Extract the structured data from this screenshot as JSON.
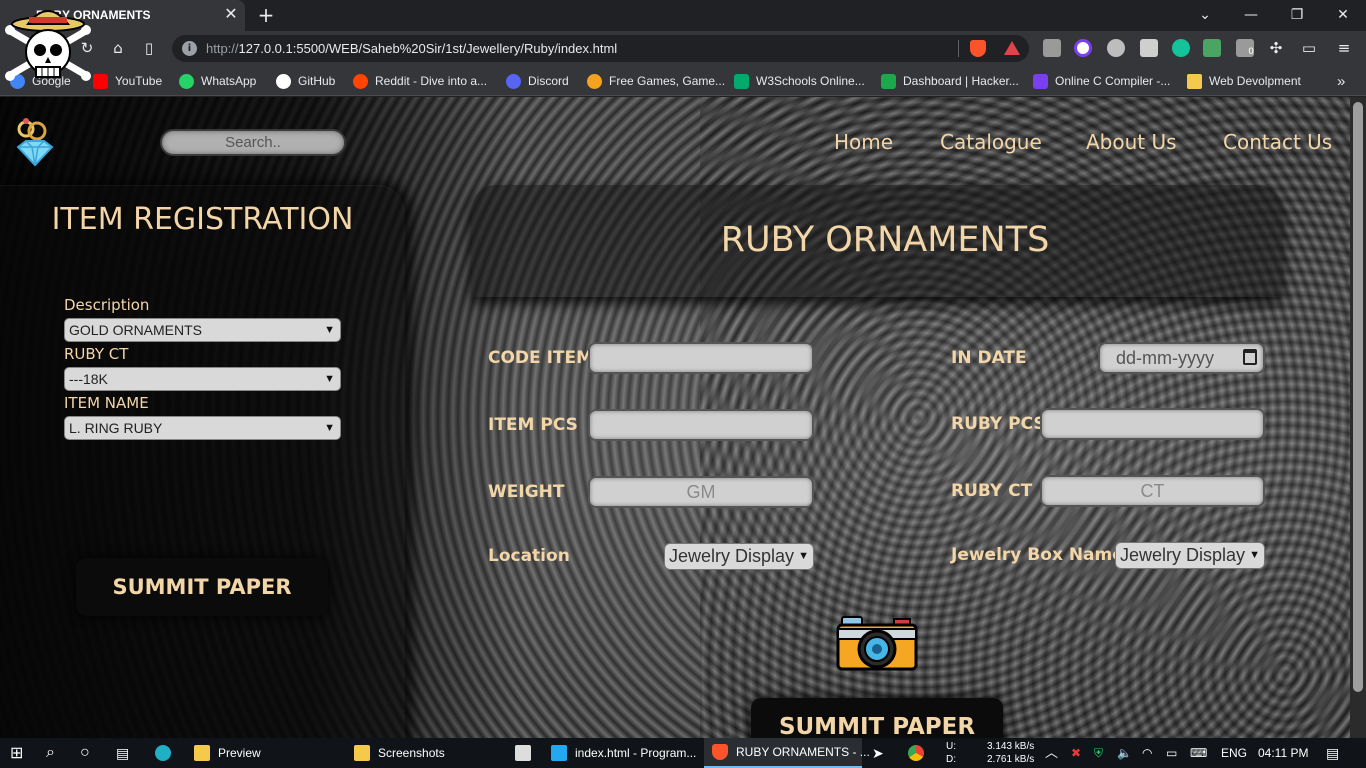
{
  "browser": {
    "tab_title": "RUBY ORNAMENTS",
    "tab_close": "✕",
    "new_tab": "+",
    "url_prefix": "http://",
    "url_host": "127.0.0.1",
    "url_rest": ":5500/WEB/Saheb%20Sir/1st/Jewellery/Ruby/index.html",
    "bookmarks": [
      {
        "label": "Google",
        "color": "#4285f4"
      },
      {
        "label": "YouTube",
        "color": "#ff0000"
      },
      {
        "label": "WhatsApp",
        "color": "#25d366"
      },
      {
        "label": "GitHub",
        "color": "#ffffff"
      },
      {
        "label": "Reddit - Dive into a...",
        "color": "#ff4500"
      },
      {
        "label": "Discord",
        "color": "#5865f2"
      },
      {
        "label": "Free Games, Game...",
        "color": "#f6a21e"
      },
      {
        "label": "W3Schools Online...",
        "color": "#04aa6d"
      },
      {
        "label": "Dashboard | Hacker...",
        "color": "#1ba94c"
      },
      {
        "label": "Online C Compiler -...",
        "color": "#7b3ff2"
      },
      {
        "label": "Web Devolpment",
        "color": "#f5c94c"
      }
    ],
    "more_bookmarks": "»",
    "extension_badge": "0"
  },
  "page": {
    "search_placeholder": "Search..",
    "nav": [
      "Home",
      "Catalogue",
      "About Us",
      "Contact Us"
    ],
    "sidebar": {
      "title": "ITEM REGISTRATION",
      "description_label": "Description",
      "description_value": "GOLD ORNAMENTS",
      "ruby_ct_label": "RUBY CT",
      "ruby_ct_value": "---18K",
      "item_name_label": "ITEM NAME",
      "item_name_value": "L. RING RUBY",
      "submit_label": "SUMMIT PAPER"
    },
    "hero_title": "RUBY ORNAMENTS",
    "form": {
      "code_item_label": "CODE ITEM",
      "in_date_label": "IN DATE",
      "in_date_placeholder": "dd-mm-yyyy",
      "item_pcs_label": "ITEM PCS",
      "ruby_pcs_label": "RUBY PCS",
      "weight_label": "WEIGHT",
      "weight_placeholder": "GM",
      "ruby_ct_label": "RUBY CT",
      "ruby_ct_placeholder": "CT",
      "location_label": "Location",
      "location_value": "Jewelry Display",
      "box_name_label": "Jewelry Box Name",
      "box_name_value": "Jewelry Display",
      "submit_label": "SUMMIT PAPER"
    }
  },
  "taskbar": {
    "items": [
      "Preview",
      "Screenshots",
      "index.html - Program...",
      "RUBY ORNAMENTS - ..."
    ],
    "net_up_label": "U:",
    "net_down_label": "D:",
    "net_up": "3.143 kB/s",
    "net_down": "2.761 kB/s",
    "language": "ENG",
    "time": "04:11 PM"
  },
  "colors": {
    "accent_text": "#f3d6a8",
    "chrome_bg": "#35363a",
    "taskbar_bg": "#101418"
  }
}
